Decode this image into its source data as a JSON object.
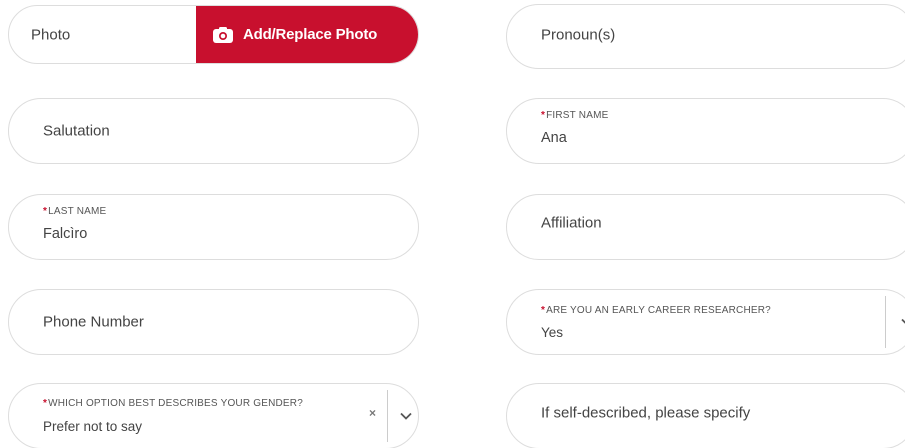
{
  "photo": {
    "label": "Photo",
    "button_label": "Add/Replace Photo",
    "button_icon": "camera-icon",
    "accent_color": "#c8102e"
  },
  "pronouns": {
    "placeholder": "Pronoun(s)"
  },
  "salutation": {
    "placeholder": "Salutation"
  },
  "first_name": {
    "required_mark": "*",
    "label": "FIRST NAME",
    "value": "Ana"
  },
  "last_name": {
    "required_mark": "*",
    "label": "LAST NAME",
    "value": "Falcìro"
  },
  "affiliation": {
    "placeholder": "Affiliation"
  },
  "phone": {
    "placeholder": "Phone Number"
  },
  "early_career": {
    "required_mark": "*",
    "label": "ARE YOU AN EARLY CAREER RESEARCHER?",
    "value": "Yes",
    "icon": "chevron-down-icon"
  },
  "gender": {
    "required_mark": "*",
    "label": "WHICH OPTION BEST DESCRIBES YOUR GENDER?",
    "value": "Prefer not to say",
    "clear_glyph": "×",
    "icon": "chevron-down-icon"
  },
  "self_described": {
    "placeholder": "If self-described, please specify"
  }
}
